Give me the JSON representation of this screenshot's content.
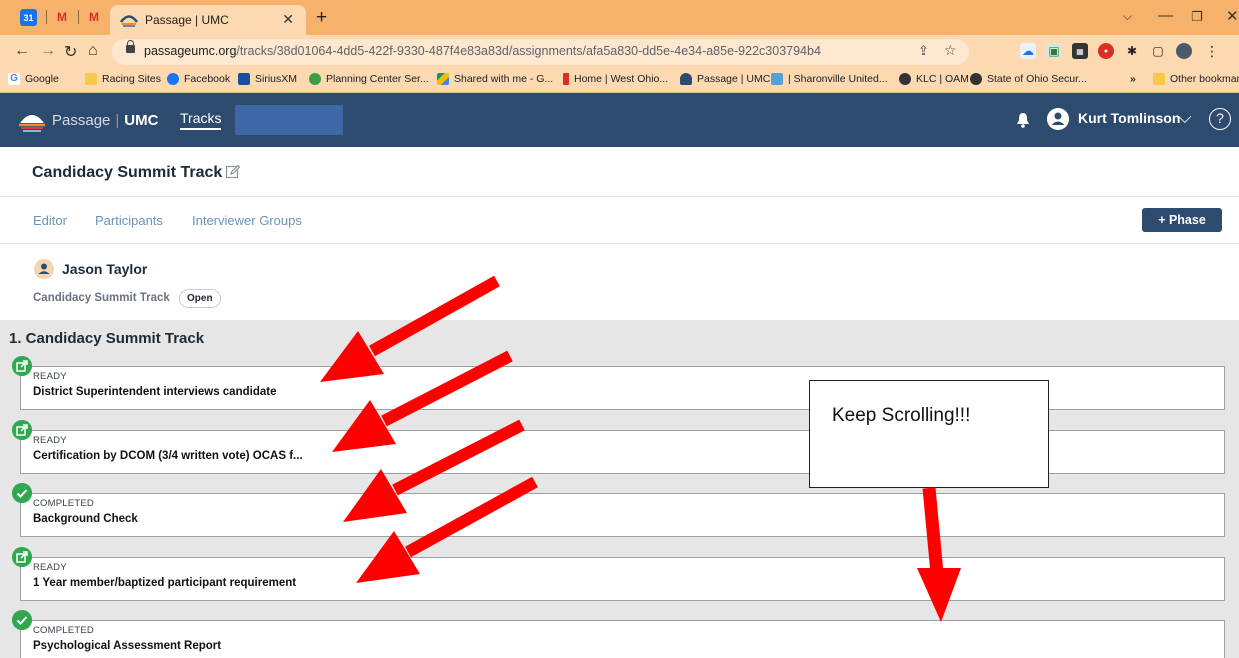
{
  "browser": {
    "tab_title": "Passage | UMC",
    "url_domain": "passageumc.org",
    "url_path": "/tracks/38d01064-4dd5-422f-9330-487f4e83a83d/assignments/afa5a830-dd5e-4e34-a85e-922c303794b4",
    "bookmarks": [
      "Google",
      "Racing Sites",
      "Facebook",
      "SiriusXM",
      "Planning Center Ser...",
      "Shared with me - G...",
      "Home | West Ohio...",
      "Passage | UMC",
      "| Sharonville United...",
      "KLC | OAM",
      "State of Ohio Secur..."
    ],
    "more_bookmarks": "»",
    "other_bookmarks": "Other bookmarks",
    "icons": [
      "calendar-icon",
      "gmail-icon",
      "close-icon",
      "new-tab-icon",
      "back-icon",
      "forward-icon",
      "reload-icon",
      "home-icon",
      "lock-icon",
      "share-icon",
      "star-icon",
      "minimize-icon",
      "maximize-icon"
    ]
  },
  "header": {
    "logo_text": "Passage",
    "logo_sep": "|",
    "logo_umc": "UMC",
    "nav_tracks": "Tracks",
    "user_name": "Kurt Tomlinson",
    "help_glyph": "?",
    "icons": [
      "bell-icon",
      "user-icon",
      "chevron-down-icon",
      "help-icon"
    ]
  },
  "page": {
    "title": "Candidacy Summit Track",
    "tabs": [
      "Editor",
      "Participants",
      "Interviewer Groups"
    ],
    "phase_button": "+ Phase"
  },
  "participant": {
    "name": "Jason Taylor",
    "track": "Candidacy Summit Track",
    "status": "Open"
  },
  "phase": {
    "title": "1. Candidacy Summit Track",
    "steps": [
      {
        "status": "READY",
        "title": "District Superintendent interviews candidate",
        "icon": "launch-icon"
      },
      {
        "status": "READY",
        "title": "Certification by DCOM (3/4 written vote) OCAS f...",
        "icon": "launch-icon"
      },
      {
        "status": "COMPLETED",
        "title": "Background Check",
        "icon": "check-icon"
      },
      {
        "status": "READY",
        "title": "1 Year member/baptized participant requirement",
        "icon": "launch-icon"
      },
      {
        "status": "COMPLETED",
        "title": "Psychological Assessment Report",
        "icon": "check-icon"
      }
    ]
  },
  "annotation": {
    "callout": "Keep Scrolling!!!"
  },
  "colors": {
    "tab_strip": "#f6b26b",
    "app_header": "#2d4a6f",
    "link": "#6b93bb",
    "status_green": "#2fa84f",
    "annotation_arrow": "#ff0000"
  }
}
